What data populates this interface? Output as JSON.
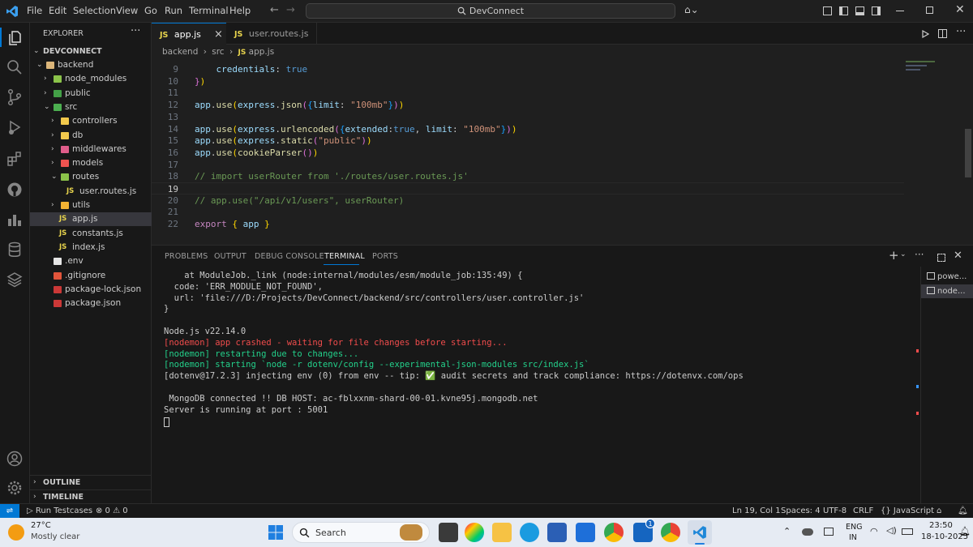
{
  "titlebar": {
    "menus": [
      "File",
      "Edit",
      "Selection",
      "View",
      "Go",
      "Run",
      "Terminal",
      "Help"
    ],
    "search_text": "DevConnect"
  },
  "explorer": {
    "header": "EXPLORER",
    "root": "DEVCONNECT",
    "items": [
      {
        "label": "backend",
        "depth": 1,
        "expanded": true,
        "kind": "folder"
      },
      {
        "label": "node_modules",
        "depth": 2,
        "expanded": false,
        "kind": "folder"
      },
      {
        "label": "public",
        "depth": 2,
        "expanded": false,
        "kind": "folder"
      },
      {
        "label": "src",
        "depth": 2,
        "expanded": true,
        "kind": "folder"
      },
      {
        "label": "controllers",
        "depth": 3,
        "expanded": false,
        "kind": "folder"
      },
      {
        "label": "db",
        "depth": 3,
        "expanded": false,
        "kind": "folder"
      },
      {
        "label": "middlewares",
        "depth": 3,
        "expanded": false,
        "kind": "folder"
      },
      {
        "label": "models",
        "depth": 3,
        "expanded": false,
        "kind": "folder"
      },
      {
        "label": "routes",
        "depth": 3,
        "expanded": true,
        "kind": "folder"
      },
      {
        "label": "user.routes.js",
        "depth": 4,
        "kind": "js"
      },
      {
        "label": "utils",
        "depth": 3,
        "expanded": false,
        "kind": "folder"
      },
      {
        "label": "app.js",
        "depth": 3,
        "kind": "js",
        "selected": true
      },
      {
        "label": "constants.js",
        "depth": 3,
        "kind": "js"
      },
      {
        "label": "index.js",
        "depth": 3,
        "kind": "js"
      },
      {
        "label": ".env",
        "depth": 2,
        "kind": "env"
      },
      {
        "label": ".gitignore",
        "depth": 2,
        "kind": "git"
      },
      {
        "label": "package-lock.json",
        "depth": 2,
        "kind": "npm"
      },
      {
        "label": "package.json",
        "depth": 2,
        "kind": "npm"
      }
    ],
    "outline": "OUTLINE",
    "timeline": "TIMELINE"
  },
  "tabs": [
    {
      "icon": "JS",
      "label": "app.js",
      "active": true,
      "close": "×"
    },
    {
      "icon": "JS",
      "label": "user.routes.js",
      "active": false
    }
  ],
  "breadcrumb": [
    "backend",
    "src",
    "JS",
    "app.js"
  ],
  "code": [
    {
      "n": "9",
      "tokens": [
        [
          "    ",
          "pl"
        ],
        [
          "credentials",
          "obj"
        ],
        [
          ": ",
          "pl"
        ],
        [
          "true",
          "kw"
        ]
      ]
    },
    {
      "n": "10",
      "tokens": [
        [
          "}",
          "br2"
        ],
        [
          ")",
          "br1"
        ]
      ]
    },
    {
      "n": "11",
      "tokens": []
    },
    {
      "n": "12",
      "tokens": [
        [
          "app",
          "obj"
        ],
        [
          ".",
          "pl"
        ],
        [
          "use",
          "fn"
        ],
        [
          "(",
          "br1"
        ],
        [
          "express",
          "obj"
        ],
        [
          ".",
          "pl"
        ],
        [
          "json",
          "fn"
        ],
        [
          "(",
          "br2"
        ],
        [
          "{",
          "br3"
        ],
        [
          "limit",
          "obj"
        ],
        [
          ": ",
          "pl"
        ],
        [
          "\"100mb\"",
          "str"
        ],
        [
          "}",
          "br3"
        ],
        [
          ")",
          "br2"
        ],
        [
          ")",
          "br1"
        ]
      ]
    },
    {
      "n": "13",
      "tokens": []
    },
    {
      "n": "14",
      "tokens": [
        [
          "app",
          "obj"
        ],
        [
          ".",
          "pl"
        ],
        [
          "use",
          "fn"
        ],
        [
          "(",
          "br1"
        ],
        [
          "express",
          "obj"
        ],
        [
          ".",
          "pl"
        ],
        [
          "urlencoded",
          "fn"
        ],
        [
          "(",
          "br2"
        ],
        [
          "{",
          "br3"
        ],
        [
          "extended",
          "obj"
        ],
        [
          ":",
          "pl"
        ],
        [
          "true",
          "kw"
        ],
        [
          ", ",
          "pl"
        ],
        [
          "limit",
          "obj"
        ],
        [
          ": ",
          "pl"
        ],
        [
          "\"100mb\"",
          "str"
        ],
        [
          "}",
          "br3"
        ],
        [
          ")",
          "br2"
        ],
        [
          ")",
          "br1"
        ]
      ]
    },
    {
      "n": "15",
      "tokens": [
        [
          "app",
          "obj"
        ],
        [
          ".",
          "pl"
        ],
        [
          "use",
          "fn"
        ],
        [
          "(",
          "br1"
        ],
        [
          "express",
          "obj"
        ],
        [
          ".",
          "pl"
        ],
        [
          "static",
          "fn"
        ],
        [
          "(",
          "br2"
        ],
        [
          "\"public\"",
          "str"
        ],
        [
          ")",
          "br2"
        ],
        [
          ")",
          "br1"
        ]
      ]
    },
    {
      "n": "16",
      "tokens": [
        [
          "app",
          "obj"
        ],
        [
          ".",
          "pl"
        ],
        [
          "use",
          "fn"
        ],
        [
          "(",
          "br1"
        ],
        [
          "cookieParser",
          "fn"
        ],
        [
          "(",
          "br2"
        ],
        [
          ")",
          "br2"
        ],
        [
          ")",
          "br1"
        ]
      ]
    },
    {
      "n": "17",
      "tokens": []
    },
    {
      "n": "18",
      "tokens": [
        [
          "// import userRouter from './routes/user.routes.js'",
          "com"
        ]
      ]
    },
    {
      "n": "19",
      "tokens": []
    },
    {
      "n": "20",
      "tokens": [
        [
          "// app.use(\"/api/v1/users\", userRouter)",
          "com"
        ]
      ]
    },
    {
      "n": "21",
      "tokens": []
    },
    {
      "n": "22",
      "tokens": [
        [
          "export",
          "ctl"
        ],
        [
          " ",
          "pl"
        ],
        [
          "{",
          "br1"
        ],
        [
          " ",
          "pl"
        ],
        [
          "app",
          "obj"
        ],
        [
          " ",
          "pl"
        ],
        [
          "}",
          "br1"
        ]
      ]
    }
  ],
  "panel": {
    "tabs": [
      "PROBLEMS",
      "OUTPUT",
      "DEBUG CONSOLE",
      "TERMINAL",
      "PORTS"
    ],
    "active_tab": "TERMINAL",
    "terminals": [
      "powe...",
      "node..."
    ],
    "lines": [
      {
        "text": "    at ModuleJob._link (node:internal/modules/esm/module_job:135:49) {",
        "color": "#cccccc"
      },
      {
        "text": "  code: 'ERR_MODULE_NOT_FOUND',",
        "color": "#cccccc"
      },
      {
        "text": "  url: 'file:///D:/Projects/DevConnect/backend/src/controllers/user.controller.js'",
        "color": "#cccccc"
      },
      {
        "text": "}",
        "color": "#cccccc"
      },
      {
        "text": "",
        "color": "#cccccc"
      },
      {
        "text": "Node.js v22.14.0",
        "color": "#cccccc"
      },
      {
        "text": "[nodemon] app crashed - waiting for file changes before starting...",
        "color": "#f14c4c"
      },
      {
        "text": "[nodemon] restarting due to changes...",
        "color": "#23d18b"
      },
      {
        "text": "[nodemon] starting `node -r dotenv/config --experimental-json-modules src/index.js`",
        "color": "#23d18b"
      },
      {
        "text": "[dotenv@17.2.3] injecting env (0) from env -- tip: ✅ audit secrets and track compliance: https://dotenvx.com/ops",
        "color": "#cccccc"
      },
      {
        "text": "",
        "color": "#cccccc"
      },
      {
        "text": " MongoDB connected !! DB HOST: ac-fblxxnm-shard-00-01.kvne95j.mongodb.net",
        "color": "#cccccc"
      },
      {
        "text": "Server is running at port : 5001",
        "color": "#cccccc"
      }
    ]
  },
  "statusbar": {
    "run_testcases": "Run Testcases",
    "problems": "⊗ 0 ⚠ 0",
    "position": "Ln 19, Col 1",
    "spaces": "Spaces: 4",
    "encoding": "UTF-8",
    "eol": "CRLF",
    "language": "{} JavaScript"
  },
  "taskbar": {
    "weather_temp": "27°C",
    "weather_desc": "Mostly clear",
    "search": "Search",
    "lang1": "ENG",
    "lang2": "IN",
    "time": "23:50",
    "date": "18-10-2025",
    "badge": "1"
  }
}
